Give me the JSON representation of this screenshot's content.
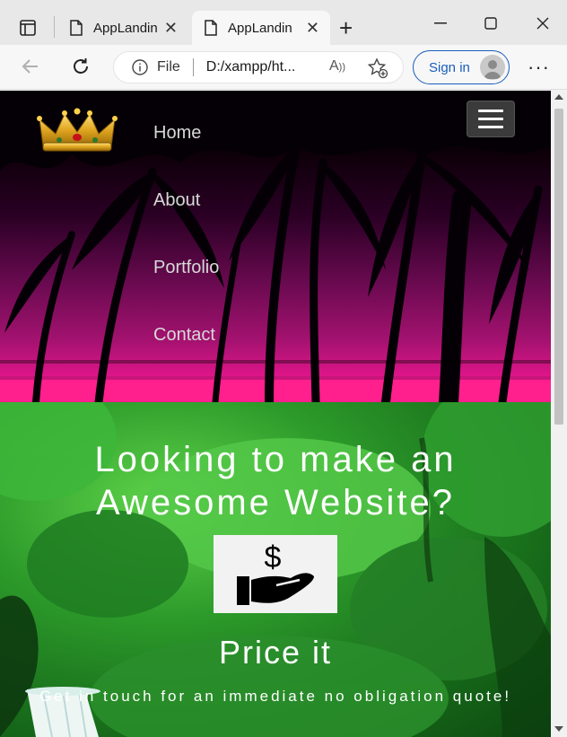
{
  "browser": {
    "tabs": [
      {
        "label": "AppLandin",
        "active": false
      },
      {
        "label": "AppLandin",
        "active": true
      }
    ],
    "address": {
      "scheme_label": "File",
      "url": "D:/xampp/ht..."
    },
    "signin_label": "Sign in",
    "icons": [
      "tab-actions-icon",
      "document-icon",
      "close-icon",
      "new-tab-icon",
      "minimize-icon",
      "maximize-icon",
      "window-close-icon",
      "back-icon",
      "reload-icon",
      "info-icon",
      "read-aloud-icon",
      "favorites-add-icon",
      "avatar-icon",
      "more-icon"
    ]
  },
  "site": {
    "nav": {
      "items": [
        "Home",
        "About",
        "Portfolio",
        "Contact"
      ],
      "logo_icon": "crown-icon",
      "menu_icon": "hamburger-icon"
    },
    "hero": {
      "headline_line1": "Looking to make an",
      "headline_line2": "Awesome Website?",
      "icon": "dollar-hand-icon",
      "price_title": "Price it",
      "subtext": "Get in touch for an immediate no obligation quote!"
    }
  },
  "colors": {
    "nav_text": "#d8d8d8",
    "hamburger_bg": "#3b3b3b",
    "signin_accent": "#1a5dbd",
    "sunset_pink": "#ff1e8c"
  }
}
